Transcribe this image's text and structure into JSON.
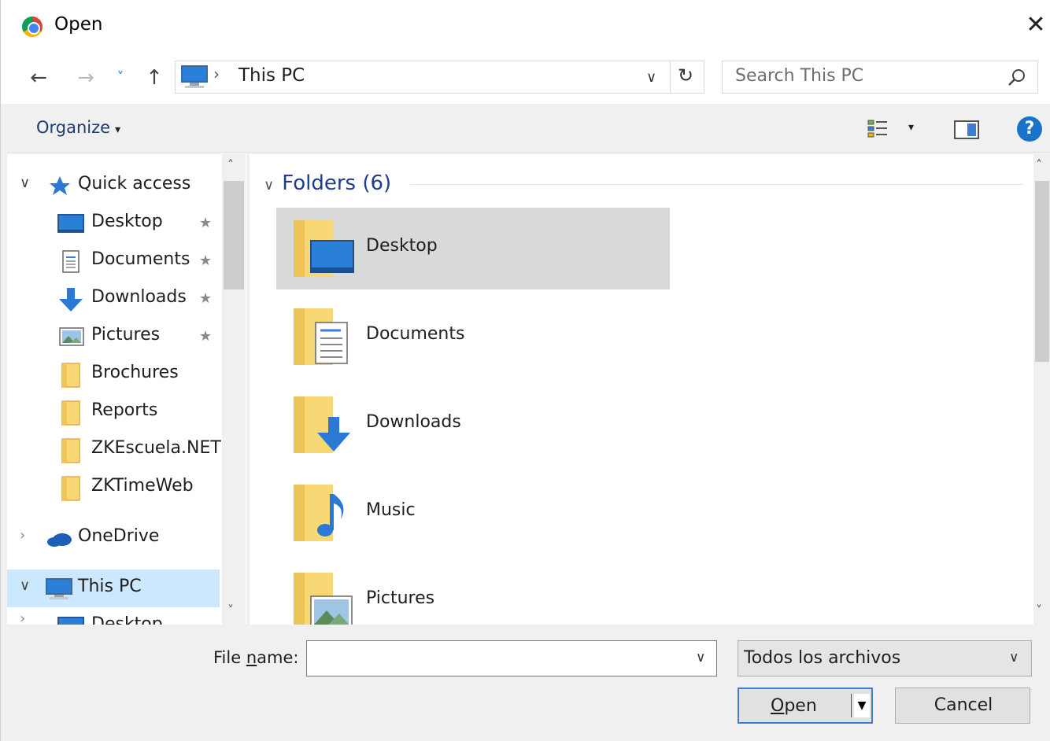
{
  "window": {
    "title": "Open",
    "close_glyph": "✕"
  },
  "nav": {
    "back_glyph": "←",
    "forward_glyph": "→",
    "recent_glyph": "˅",
    "up_glyph": "↑",
    "address_separator": "›",
    "address_location": "This PC",
    "address_dropdown_glyph": "∨",
    "refresh_glyph": "↻",
    "search_placeholder": "Search This PC"
  },
  "toolbar": {
    "organize_label": "Organize",
    "caret": "▾",
    "view_caret": "▾",
    "help_glyph": "?"
  },
  "sidebar": {
    "quick_access": "Quick access",
    "items": [
      {
        "label": "Desktop",
        "icon": "desktop-icon",
        "pinned": true
      },
      {
        "label": "Documents",
        "icon": "documents-icon",
        "pinned": true
      },
      {
        "label": "Downloads",
        "icon": "downloads-icon",
        "pinned": true
      },
      {
        "label": "Pictures",
        "icon": "pictures-icon",
        "pinned": true
      },
      {
        "label": "Brochures",
        "icon": "folder-icon",
        "pinned": false
      },
      {
        "label": "Reports",
        "icon": "folder-icon",
        "pinned": false
      },
      {
        "label": "ZKEscuela.NET",
        "icon": "folder-icon",
        "pinned": false
      },
      {
        "label": "ZKTimeWeb",
        "icon": "folder-icon",
        "pinned": false
      }
    ],
    "onedrive": "OneDrive",
    "this_pc": "This PC",
    "this_pc_child": "Desktop",
    "pin_glyph": "★",
    "expanded_chevron": "∨",
    "collapsed_chevron": "›",
    "scroll_up": "˄",
    "scroll_down": "˅"
  },
  "content": {
    "group_chevron": "∨",
    "group_label": "Folders (6)",
    "folders": [
      {
        "label": "Desktop",
        "icon": "desktop-folder-icon",
        "selected": true
      },
      {
        "label": "Documents",
        "icon": "documents-folder-icon",
        "selected": false
      },
      {
        "label": "Downloads",
        "icon": "downloads-folder-icon",
        "selected": false
      },
      {
        "label": "Music",
        "icon": "music-folder-icon",
        "selected": false
      },
      {
        "label": "Pictures",
        "icon": "pictures-folder-icon",
        "selected": false
      }
    ]
  },
  "footer": {
    "file_name_pre": "File ",
    "file_name_u": "n",
    "file_name_post": "ame:",
    "file_name_value": "",
    "file_name_dropdown": "∨",
    "filter_value": "Todos los archivos",
    "filter_dropdown": "∨",
    "open_u": "O",
    "open_rest": "pen",
    "open_arrow": "▼",
    "cancel_label": "Cancel"
  },
  "colors": {
    "accent": "#1a73c8",
    "selection": "#cce8ff",
    "folder": "#f8d775"
  }
}
